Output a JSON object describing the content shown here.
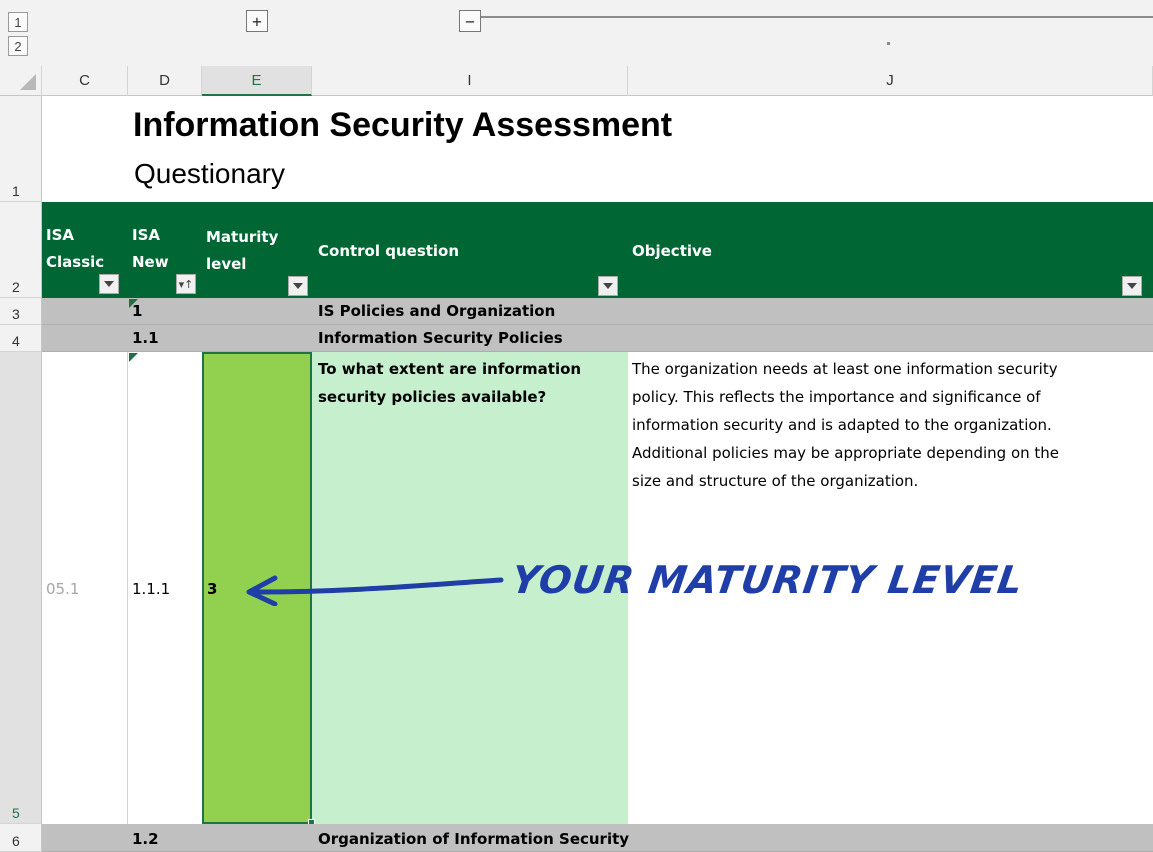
{
  "outline": {
    "level1": "1",
    "level2": "2",
    "expand": "+",
    "collapse": "−"
  },
  "columns": {
    "c": "C",
    "d": "D",
    "e": "E",
    "i": "I",
    "j": "J"
  },
  "rows": {
    "r1": "1",
    "r2": "2",
    "r3": "3",
    "r4": "4",
    "r5": "5",
    "r6": "6"
  },
  "title": "Information Security Assessment",
  "subtitle": "Questionary",
  "headers": {
    "isa_classic_1": "ISA",
    "isa_classic_2": "Classic",
    "isa_new_1": "ISA",
    "isa_new_2": "New",
    "maturity_1": "Maturity",
    "maturity_2": "level",
    "control_question": "Control question",
    "objective": "Objective"
  },
  "sections": [
    {
      "isa_new": "1",
      "title": "IS Policies and Organization"
    },
    {
      "isa_new": "1.1",
      "title": "Information Security Policies"
    },
    {
      "isa_new": "1.2",
      "title": "Organization of Information Security"
    }
  ],
  "entry": {
    "isa_classic": "05.1",
    "isa_new": "1.1.1",
    "maturity_level": "3",
    "question_1": "To what extent are information",
    "question_2": "security policies available?",
    "objective_lines": [
      "The organization needs at least one information security",
      "policy. This reflects the importance and significance of",
      "information security and is adapted to the organization.",
      "Additional policies may be appropriate depending on the",
      "size and structure of the organization."
    ]
  },
  "annotation": "YOUR MATURITY LEVEL",
  "colors": {
    "header_green": "#006633",
    "maturity_fill": "#92d050",
    "question_fill": "#c6efce",
    "section_gray": "#c0c0c0",
    "annotation_blue": "#1f3ea8"
  }
}
